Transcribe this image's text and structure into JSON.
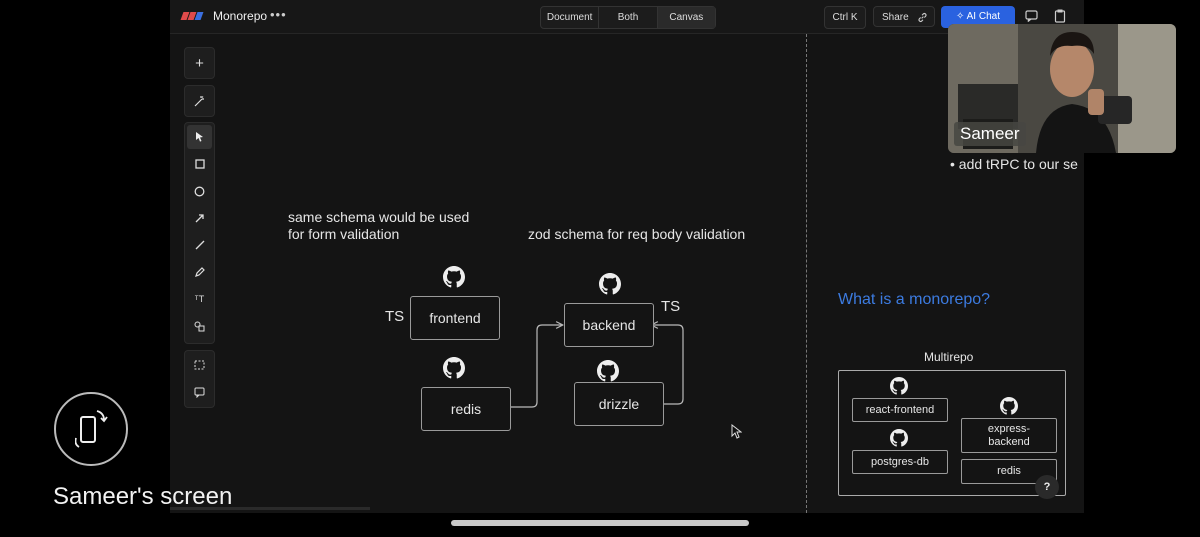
{
  "app": {
    "title": "Monorepo",
    "more_label": "•••",
    "view_tabs": [
      "Document",
      "Both",
      "Canvas"
    ],
    "shortcut_label": "Ctrl K",
    "share_label": "Share",
    "ai_chat_label": "AI Chat",
    "brand_colors": [
      "#e04b4b",
      "#3b6fe0"
    ]
  },
  "canvas": {
    "note_left": [
      "same schema would be used",
      "for form validation"
    ],
    "note_right": "zod schema for req body validation",
    "ts_left": "TS",
    "ts_right": "TS",
    "nodes": {
      "frontend": "frontend",
      "backend": "backend",
      "redis": "redis",
      "drizzle": "drizzle"
    }
  },
  "doc": {
    "bullet_partial": "• add tRPC to our se",
    "heading": "What is a monorepo?",
    "heading_color": "#3c7be0",
    "multirepo_title": "Multirepo",
    "repos": {
      "react_frontend": "react-frontend",
      "postgres_db": "postgres-db",
      "express_backend": [
        "express-",
        "backend"
      ],
      "redis": "redis"
    },
    "help_label": "?"
  },
  "call": {
    "participant": "Sameer",
    "screen_label": "Sameer's screen"
  }
}
